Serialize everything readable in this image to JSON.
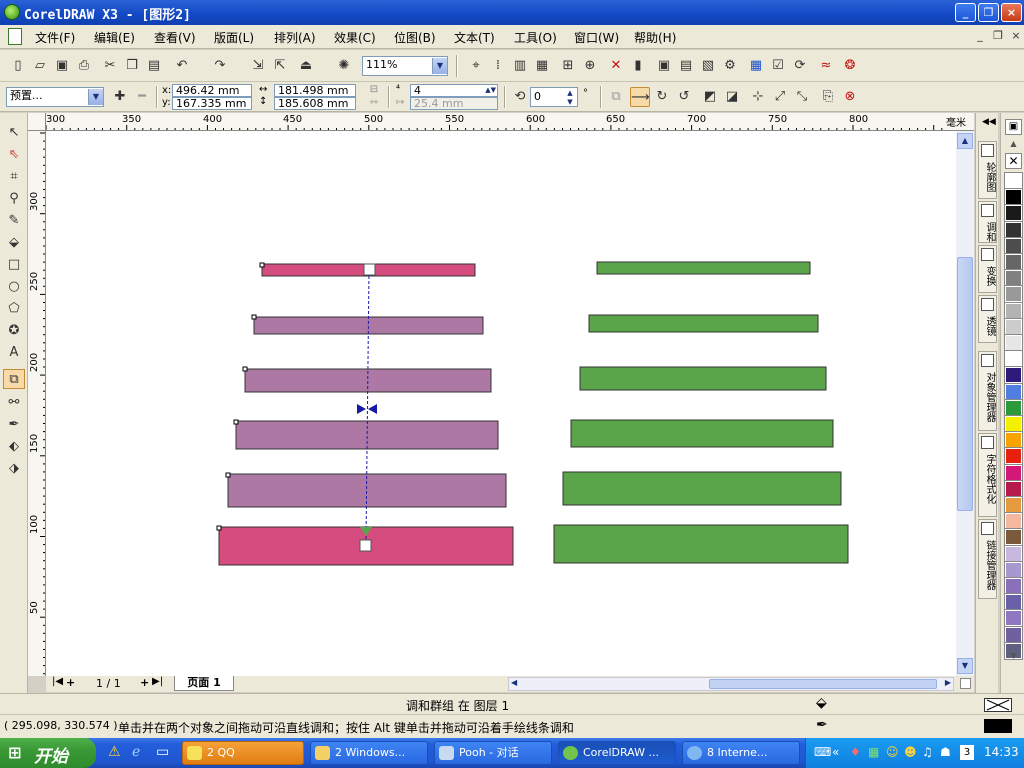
{
  "window": {
    "title": "CorelDRAW X3 - [图形2]",
    "buttons": [
      "_",
      "❐",
      "×"
    ],
    "mdi_buttons": [
      "_",
      "❐",
      "×"
    ]
  },
  "menu": [
    "文件(F)",
    "编辑(E)",
    "查看(V)",
    "版面(L)",
    "排列(A)",
    "效果(C)",
    "位图(B)",
    "文本(T)",
    "工具(O)",
    "窗口(W)",
    "帮助(H)"
  ],
  "toolbar": {
    "zoom": "111%",
    "preset": "预置...",
    "x": "496.42 mm",
    "y": "167.335 mm",
    "width": "181.498 mm",
    "height": "185.608 mm",
    "x_label": "x:",
    "y_label": "y:",
    "steps": "4",
    "spacing": "25.4 mm",
    "rotation": "0",
    "degree": "°"
  },
  "ruler": {
    "h_labels": [
      "300",
      "350",
      "400",
      "450",
      "500",
      "550",
      "600",
      "650",
      "700",
      "750",
      "800"
    ],
    "v_labels": [
      "300",
      "250",
      "200",
      "150",
      "100",
      "50"
    ],
    "unit": "毫米"
  },
  "canvas": {
    "pink_color": "#d44d7e",
    "purple_color": "#ad78a4",
    "green_color": "#5aa54a",
    "guide_color": "#1a1aa8"
  },
  "pages": {
    "counter": "1 / 1",
    "tab": "页面 1"
  },
  "dockers": [
    "轮廓图",
    "调和",
    "变换",
    "透镜",
    "对象管理器",
    "字符格式化",
    "链接管理器"
  ],
  "palette": [
    "#ffffff",
    "#000000",
    "#1a1a1a",
    "#333333",
    "#4d4d4d",
    "#666666",
    "#808080",
    "#999999",
    "#b3b3b3",
    "#cccccc",
    "#e6e6e6",
    "#ffffff",
    "#2e1a7a",
    "#4f7fe0",
    "#2d9a3a",
    "#f4f000",
    "#f7a400",
    "#e8200c",
    "#d4187a",
    "#b51a4a",
    "#e69a40",
    "#f4b8a0",
    "#7a5a3a",
    "#c8b8e0",
    "#a898d0",
    "#8a70b8",
    "#6a60a8",
    "#9078c0",
    "#7060a0",
    "#606080"
  ],
  "status": {
    "object_info": "调和群组 在 图层 1",
    "coords": "( 295.098, 330.574 )",
    "hint": "单击并在两个对象之间拖动可沿直线调和；按住 Alt 键单击并拖动可沿着手绘线条调和"
  },
  "taskbar": {
    "start": "开始",
    "tasks": [
      "2 QQ",
      "2 Windows...",
      "Pooh - 对话",
      "CorelDRAW ...",
      "8 Interne..."
    ],
    "clock": "14:33",
    "tray_num": "3"
  }
}
